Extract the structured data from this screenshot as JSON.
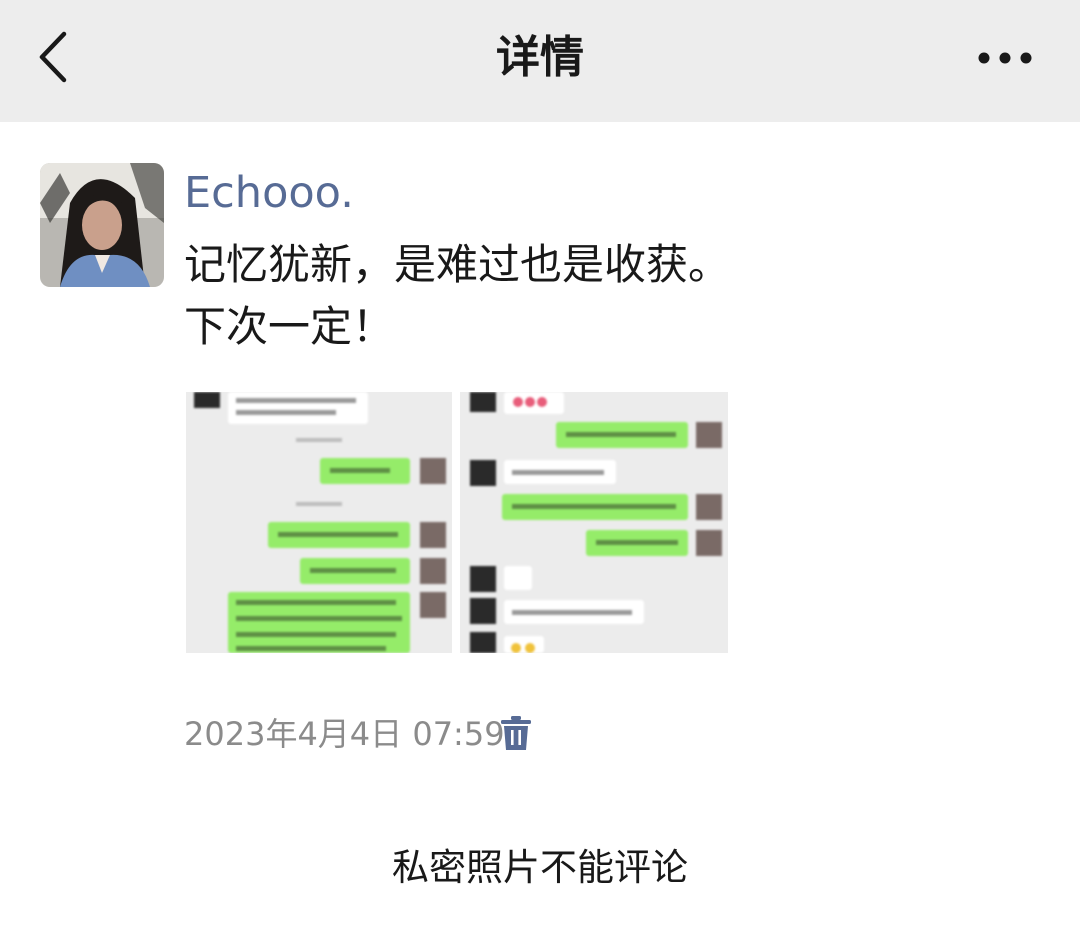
{
  "header": {
    "title": "详情",
    "back_icon": "chevron-left-icon",
    "more_icon": "more-dots-icon"
  },
  "post": {
    "username": "Echooo.",
    "text": "记忆犹新，是难过也是收获。\n下次一定！",
    "timestamp": "2023年4月4日 07:59",
    "delete_icon": "trash-icon",
    "username_color": "#576b95"
  },
  "footer": {
    "notice": "私密照片不能评论"
  }
}
